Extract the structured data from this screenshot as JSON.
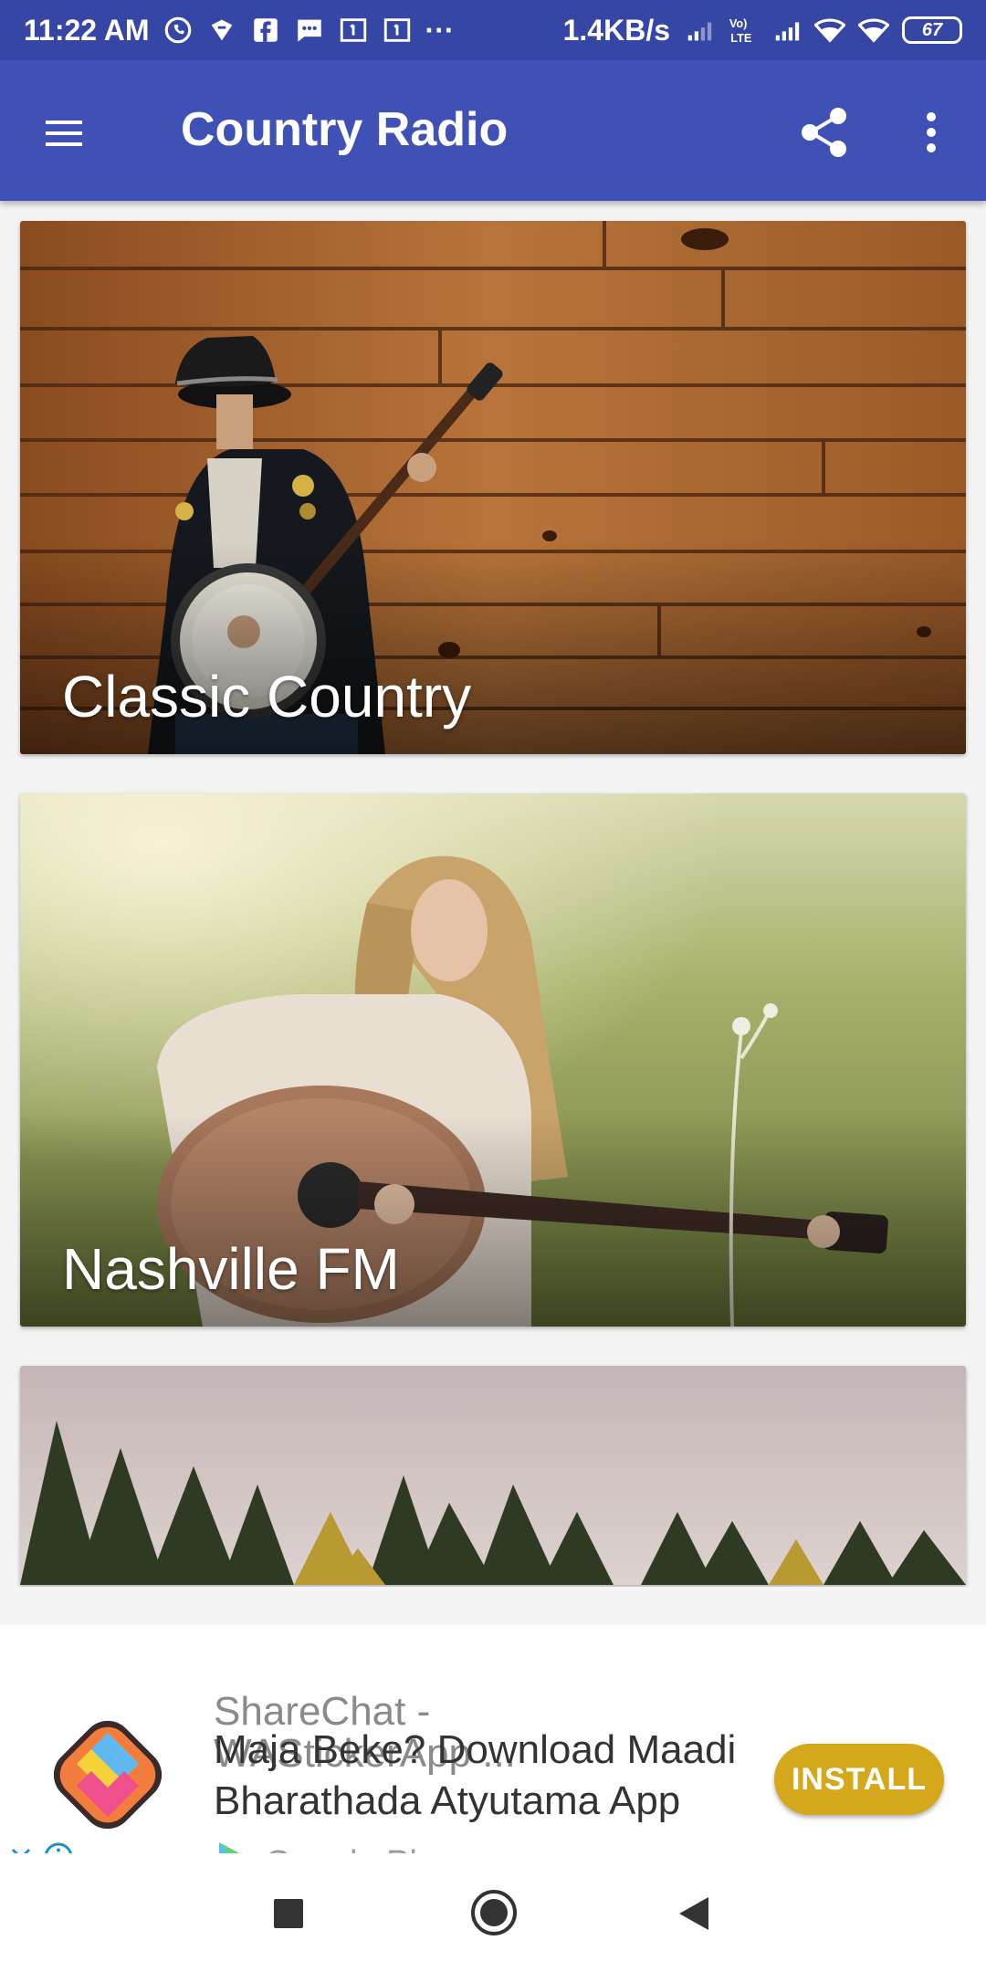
{
  "status_bar": {
    "time": "11:22 AM",
    "dots": "···",
    "net_speed": "1.4KB/s",
    "battery": "67",
    "icons": [
      "whatsapp-icon",
      "notification-icon",
      "facebook-icon",
      "message-icon",
      "sim1-icon",
      "sim1-icon",
      "signal-weak-icon",
      "volte-icon",
      "signal-icon",
      "wifi-icon",
      "wifi-icon",
      "battery-icon"
    ]
  },
  "app_bar": {
    "title": "Country Radio",
    "color": "#3f51b5",
    "status_color": "#3646a5",
    "icons": [
      "menu-icon",
      "share-icon",
      "more-vert-icon"
    ]
  },
  "stations": [
    {
      "title": "Classic Country"
    },
    {
      "title": "Nashville FM"
    },
    {
      "title": ""
    }
  ],
  "ad": {
    "app_name_line1": "ShareChat -",
    "app_name_line2": "WAStickerApp ...",
    "tagline_line1": "Maja Beke? Download Maadi",
    "tagline_line2": "Bharathada Atyutama App",
    "store": "Google Play",
    "install_label": "INSTALL",
    "install_color": "#d4a81a",
    "icons": [
      "sharechat-logo",
      "google-play-icon",
      "close-icon",
      "info-icon"
    ]
  },
  "nav_bar": {
    "icons": [
      "recents-icon",
      "home-icon",
      "back-icon"
    ]
  }
}
